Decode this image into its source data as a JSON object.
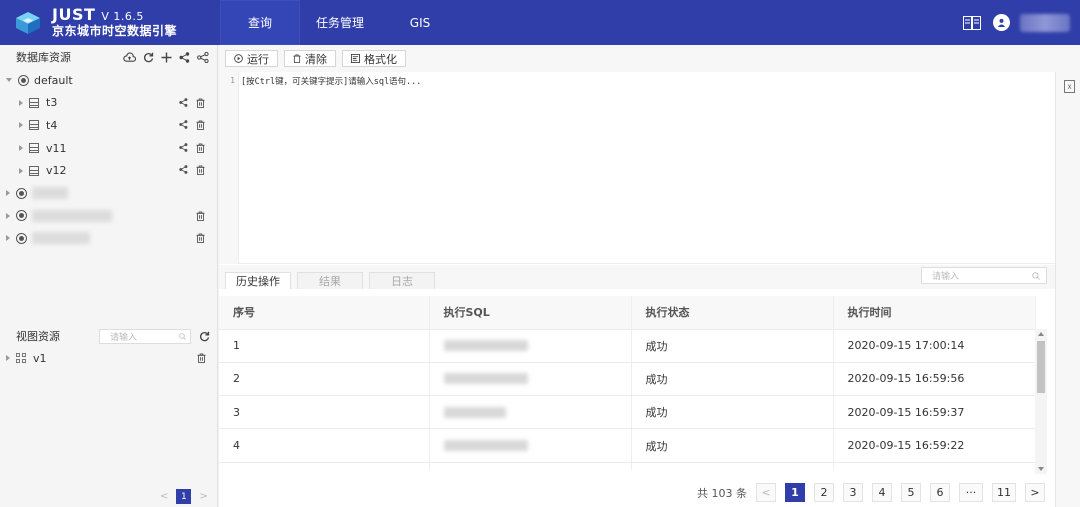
{
  "app": {
    "title": "JUST",
    "version": "V 1.6.5",
    "subtitle": "京东城市时空数据引擎"
  },
  "nav": [
    {
      "label": "查询",
      "active": true
    },
    {
      "label": "任务管理"
    },
    {
      "label": "GIS"
    }
  ],
  "header": {
    "book_icon": "book-icon",
    "user_icon": "user-icon"
  },
  "sidebar": {
    "db_title": "数据库资源",
    "tree": {
      "root": "default",
      "tables": [
        "t3",
        "t4",
        "v11",
        "v12"
      ]
    },
    "view_title": "视图资源",
    "view_search_placeholder": "请输入",
    "views": [
      "v1"
    ],
    "pager_current": "1"
  },
  "toolbar": {
    "run": "运行",
    "clear": "清除",
    "format": "格式化"
  },
  "editor": {
    "line_number": "1",
    "placeholder": "[按Ctrl键，可关键字提示]请输入sql语句..."
  },
  "tabs": [
    {
      "label": "历史操作",
      "active": true
    },
    {
      "label": "结果"
    },
    {
      "label": "日志"
    }
  ],
  "results": {
    "search_placeholder": "请输入",
    "columns": [
      "序号",
      "执行SQL",
      "执行状态",
      "执行时间"
    ],
    "rows": [
      {
        "index": "1",
        "status": "成功",
        "time": "2020-09-15 17:00:14"
      },
      {
        "index": "2",
        "status": "成功",
        "time": "2020-09-15 16:59:56"
      },
      {
        "index": "3",
        "status": "成功",
        "time": "2020-09-15 16:59:37"
      },
      {
        "index": "4",
        "status": "成功",
        "time": "2020-09-15 16:59:22"
      }
    ]
  },
  "pagination": {
    "total": "共 103 条",
    "pages": [
      "1",
      "2",
      "3",
      "4",
      "5",
      "6"
    ],
    "ellipsis": "···",
    "last": "11",
    "current": "1"
  },
  "colors": {
    "primary": "#2f3ea8",
    "header_bg": "#2f3ea8"
  }
}
